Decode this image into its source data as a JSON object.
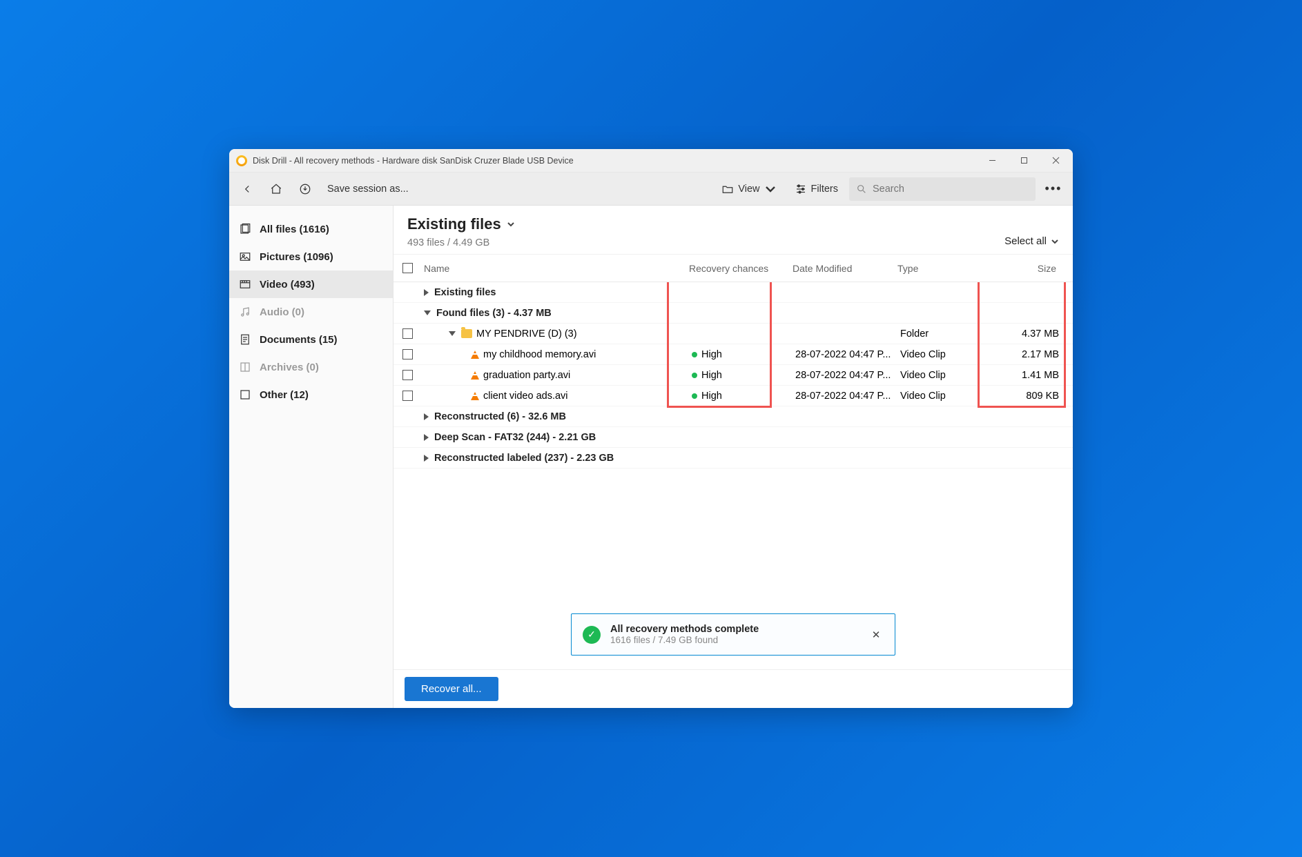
{
  "titlebar": {
    "title": "Disk Drill - All recovery methods - Hardware disk SanDisk Cruzer Blade USB Device"
  },
  "toolbar": {
    "save_session": "Save session as...",
    "view_label": "View",
    "filters_label": "Filters",
    "search_placeholder": "Search"
  },
  "sidebar": {
    "items": [
      {
        "label": "All files (1616)",
        "icon": "files",
        "muted": false,
        "active": false
      },
      {
        "label": "Pictures (1096)",
        "icon": "pictures",
        "muted": false,
        "active": false
      },
      {
        "label": "Video (493)",
        "icon": "video",
        "muted": false,
        "active": true
      },
      {
        "label": "Audio (0)",
        "icon": "audio",
        "muted": true,
        "active": false
      },
      {
        "label": "Documents (15)",
        "icon": "documents",
        "muted": false,
        "active": false
      },
      {
        "label": "Archives (0)",
        "icon": "archives",
        "muted": true,
        "active": false
      },
      {
        "label": "Other (12)",
        "icon": "other",
        "muted": false,
        "active": false
      }
    ]
  },
  "header": {
    "title": "Existing files",
    "sub": "493 files / 4.49 GB",
    "select_all": "Select all"
  },
  "columns": {
    "name": "Name",
    "recovery": "Recovery chances",
    "date": "Date Modified",
    "type": "Type",
    "size": "Size"
  },
  "groups": {
    "existing": "Existing files",
    "found": "Found files (3) - 4.37 MB",
    "pendrive": "MY PENDRIVE (D) (3)",
    "pendrive_type": "Folder",
    "pendrive_size": "4.37 MB",
    "reconstructed": "Reconstructed (6) - 32.6 MB",
    "deep": "Deep Scan - FAT32 (244) - 2.21 GB",
    "recon_labeled": "Reconstructed labeled (237) - 2.23 GB"
  },
  "files": [
    {
      "name": "my childhood memory.avi",
      "recovery": "High",
      "date": "28-07-2022 04:47 P...",
      "type": "Video Clip",
      "size": "2.17 MB"
    },
    {
      "name": "graduation party.avi",
      "recovery": "High",
      "date": "28-07-2022 04:47 P...",
      "type": "Video Clip",
      "size": "1.41 MB"
    },
    {
      "name": "client video ads.avi",
      "recovery": "High",
      "date": "28-07-2022 04:47 P...",
      "type": "Video Clip",
      "size": "809 KB"
    }
  ],
  "notify": {
    "title": "All recovery methods complete",
    "sub": "1616 files / 7.49 GB found"
  },
  "footer": {
    "recover": "Recover all..."
  }
}
